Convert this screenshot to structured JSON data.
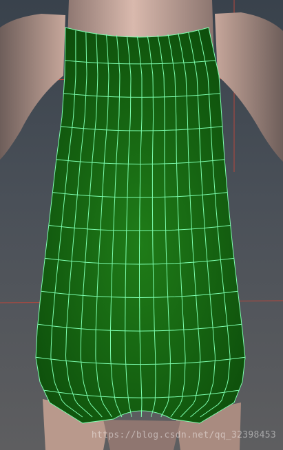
{
  "viewport": {
    "background": "#4a5058",
    "watermark": "https://blog.csdn.net/qq_32398453"
  },
  "scene": {
    "mesh": {
      "fill_color": "#1f7a1a",
      "wire_color": "#7dffb0",
      "columns": 14,
      "rows": 11
    },
    "body_skin_color": "#c9a699",
    "grid_line_color": "#c0463a"
  }
}
